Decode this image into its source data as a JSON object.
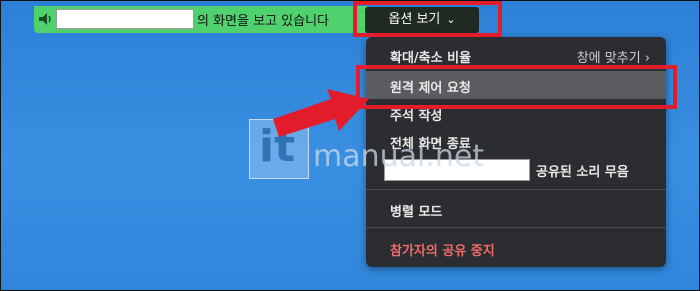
{
  "share_bar": {
    "status_text": "의 화면을 보고 있습니다",
    "options_label": "옵션 보기",
    "options_chevron": "⌄",
    "speaker_icon": "speaker-icon",
    "bar_color": "#4fd16d"
  },
  "menu": {
    "zoom": {
      "label": "확대/축소 비율",
      "value": "창에 맞추기",
      "chevron": "›"
    },
    "remote_control": {
      "label": "원격 제어 요청"
    },
    "annotate": {
      "label": "주석 작성"
    },
    "exit_fullscreen": {
      "label": "전체 화면 종료"
    },
    "mute_shared_audio": {
      "label": "공유된 소리 무음"
    },
    "side_by_side": {
      "label": "병렬 모드"
    },
    "stop_participant_share": {
      "label": "참가자의 공유 중지"
    }
  },
  "watermark": {
    "logo": "it",
    "text": "manual.net"
  },
  "colors": {
    "highlight_red": "#e21c2b",
    "menu_bg": "#2c2d30",
    "danger": "#f16a6a",
    "desktop_blue": "#3a8fe2"
  }
}
